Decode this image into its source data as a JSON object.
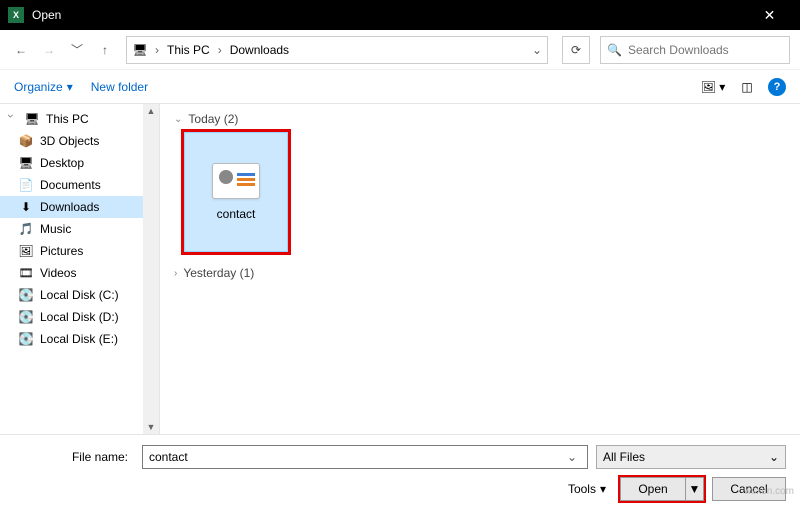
{
  "titlebar": {
    "app": "X",
    "title": "Open"
  },
  "nav": {
    "breadcrumb": [
      "This PC",
      "Downloads"
    ],
    "search_placeholder": "Search Downloads"
  },
  "toolbar": {
    "organize": "Organize",
    "newfolder": "New folder"
  },
  "sidebar": {
    "root": "This PC",
    "items": [
      {
        "label": "3D Objects",
        "icon": "📦"
      },
      {
        "label": "Desktop",
        "icon": "🖥"
      },
      {
        "label": "Documents",
        "icon": "📄"
      },
      {
        "label": "Downloads",
        "icon": "⬇",
        "active": true
      },
      {
        "label": "Music",
        "icon": "🎵"
      },
      {
        "label": "Pictures",
        "icon": "🖼"
      },
      {
        "label": "Videos",
        "icon": "🎞"
      },
      {
        "label": "Local Disk (C:)",
        "icon": "💽"
      },
      {
        "label": "Local Disk (D:)",
        "icon": "💽"
      },
      {
        "label": "Local Disk (E:)",
        "icon": "💽"
      }
    ]
  },
  "content": {
    "groups": [
      {
        "label": "Today (2)",
        "files": [
          {
            "name": "contact",
            "selected": true
          }
        ]
      },
      {
        "label": "Yesterday (1)",
        "files": []
      }
    ]
  },
  "footer": {
    "filename_label": "File name:",
    "filename_value": "contact",
    "filter": "All Files",
    "tools": "Tools",
    "open": "Open",
    "cancel": "Cancel"
  },
  "watermark": "wsxdn.com"
}
